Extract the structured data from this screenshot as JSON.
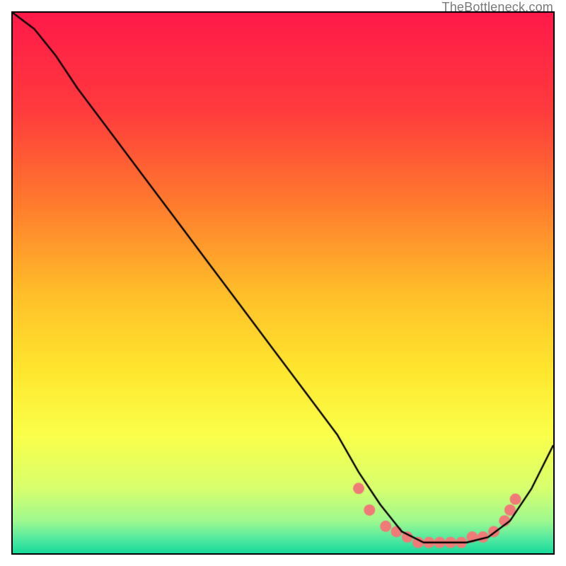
{
  "watermark": "TheBottleneck.com",
  "chart_data": {
    "type": "line",
    "title": "",
    "xlabel": "",
    "ylabel": "",
    "xlim": [
      0,
      100
    ],
    "ylim": [
      0,
      100
    ],
    "gradient_stops": [
      {
        "pos": 0.0,
        "color": "#ff1a49"
      },
      {
        "pos": 0.18,
        "color": "#ff3b3d"
      },
      {
        "pos": 0.35,
        "color": "#ff7a2e"
      },
      {
        "pos": 0.52,
        "color": "#ffbf2a"
      },
      {
        "pos": 0.66,
        "color": "#ffe62e"
      },
      {
        "pos": 0.78,
        "color": "#fbff4a"
      },
      {
        "pos": 0.88,
        "color": "#d8ff6e"
      },
      {
        "pos": 0.94,
        "color": "#9ef98f"
      },
      {
        "pos": 0.975,
        "color": "#4fe9a1"
      },
      {
        "pos": 1.0,
        "color": "#17d99a"
      }
    ],
    "series": [
      {
        "name": "curve",
        "x": [
          0,
          4,
          8,
          12,
          18,
          24,
          30,
          36,
          42,
          48,
          54,
          60,
          64,
          68,
          72,
          76,
          80,
          84,
          88,
          92,
          96,
          100
        ],
        "y": [
          100,
          97,
          92,
          86,
          78,
          70,
          62,
          54,
          46,
          38,
          30,
          22,
          15,
          9,
          4,
          2,
          2,
          2,
          3,
          6,
          12,
          20
        ]
      }
    ],
    "markers": {
      "name": "highlight-dots",
      "color": "#f07a78",
      "radius": 8,
      "x": [
        64,
        66,
        69,
        71,
        73,
        75,
        77,
        79,
        81,
        83,
        85,
        87,
        89,
        91,
        92,
        93
      ],
      "y": [
        12,
        8,
        5,
        4,
        3,
        2,
        2,
        2,
        2,
        2,
        3,
        3,
        4,
        6,
        8,
        10
      ]
    }
  }
}
